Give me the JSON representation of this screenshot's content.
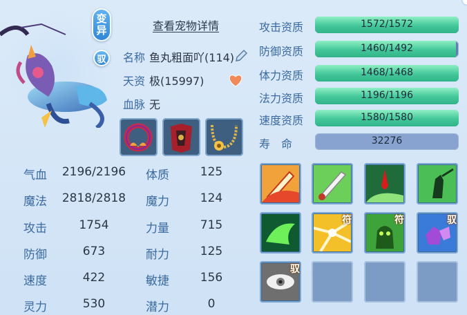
{
  "header": {
    "transform_label": "变异",
    "badge_label": "驭",
    "detail_link": "查看宠物详情"
  },
  "info": {
    "name_label": "名称",
    "name_value": "鱼丸粗面吖(114)",
    "talent_label": "天资",
    "talent_value": "极(15997)",
    "bloodline_label": "血脉",
    "bloodline_value": "无"
  },
  "equipment": [
    {
      "icon": "red-fire-collar-icon"
    },
    {
      "icon": "red-armor-icon"
    },
    {
      "icon": "gold-necklace-icon"
    }
  ],
  "stats": [
    {
      "label": "气血",
      "value": "2196/2196",
      "label2": "体质",
      "value2": "125"
    },
    {
      "label": "魔法",
      "value": "2818/2818",
      "label2": "魔力",
      "value2": "124"
    },
    {
      "label": "攻击",
      "value": "1754",
      "label2": "力量",
      "value2": "715"
    },
    {
      "label": "防御",
      "value": "673",
      "label2": "耐力",
      "value2": "125"
    },
    {
      "label": "速度",
      "value": "422",
      "label2": "敏捷",
      "value2": "156"
    },
    {
      "label": "灵力",
      "value": "530",
      "label2": "潜力",
      "value2": "0"
    }
  ],
  "aptitudes": [
    {
      "label": "攻击资质",
      "text": "1572/1572",
      "fill": 1.0
    },
    {
      "label": "防御资质",
      "text": "1460/1492",
      "fill": 0.9786
    },
    {
      "label": "体力资质",
      "text": "1468/1468",
      "fill": 1.0
    },
    {
      "label": "法力资质",
      "text": "1196/1196",
      "fill": 1.0
    },
    {
      "label": "速度资质",
      "text": "1580/1580",
      "fill": 1.0
    }
  ],
  "lifespan": {
    "label": "寿　命",
    "value": "32276"
  },
  "skills": [
    {
      "icon": "flaming-sword-icon",
      "tag": ""
    },
    {
      "icon": "white-sword-icon",
      "tag": ""
    },
    {
      "icon": "blood-drop-icon",
      "tag": ""
    },
    {
      "icon": "shadow-warrior-icon",
      "tag": ""
    },
    {
      "icon": "green-dragon-claw-icon",
      "tag": ""
    },
    {
      "icon": "golden-burst-icon",
      "tag": "符"
    },
    {
      "icon": "green-monster-icon",
      "tag": "符"
    },
    {
      "icon": "purple-crystal-icon",
      "tag": "驭"
    },
    {
      "icon": "grey-eye-icon",
      "tag": "驭"
    },
    {
      "icon": "",
      "tag": ""
    },
    {
      "icon": "",
      "tag": ""
    },
    {
      "icon": "",
      "tag": ""
    }
  ],
  "colors": {
    "label_blue": "#3a6aa0",
    "bar_green": "#43c79a",
    "bar_track": "#5f7fb0"
  }
}
